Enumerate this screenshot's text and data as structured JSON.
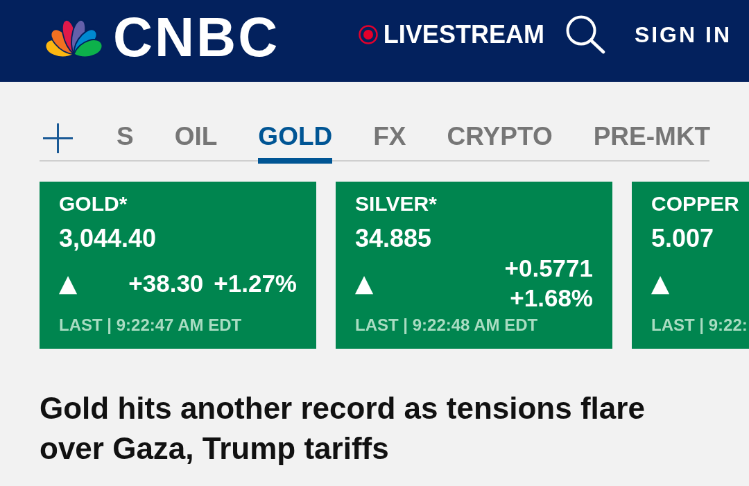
{
  "header": {
    "logo_text": "CNBC",
    "livestream": "LIVESTREAM",
    "sign_in": "SIGN IN"
  },
  "tabs": [
    {
      "label": "S",
      "selected": false
    },
    {
      "label": "OIL",
      "selected": false
    },
    {
      "label": "GOLD",
      "selected": true
    },
    {
      "label": "FX",
      "selected": false
    },
    {
      "label": "CRYPTO",
      "selected": false
    },
    {
      "label": "PRE-MKT",
      "selected": false
    }
  ],
  "quotes": [
    {
      "name": "GOLD*",
      "price": "3,044.40",
      "arrow": "▲",
      "change": "+38.30",
      "change_percent": "+1.27%",
      "last": "LAST | 9:22:47 AM EDT"
    },
    {
      "name": "SILVER*",
      "price": "34.885",
      "arrow": "▲",
      "change": "+0.5771",
      "change_percent": "+1.68%",
      "last": "LAST | 9:22:48 AM EDT"
    },
    {
      "name": "COPPER",
      "price": "5.007",
      "arrow": "▲",
      "last": "LAST | 9:22:"
    }
  ],
  "headline": "Gold hits another record as tensions flare over Gaza, Trump tariffs"
}
